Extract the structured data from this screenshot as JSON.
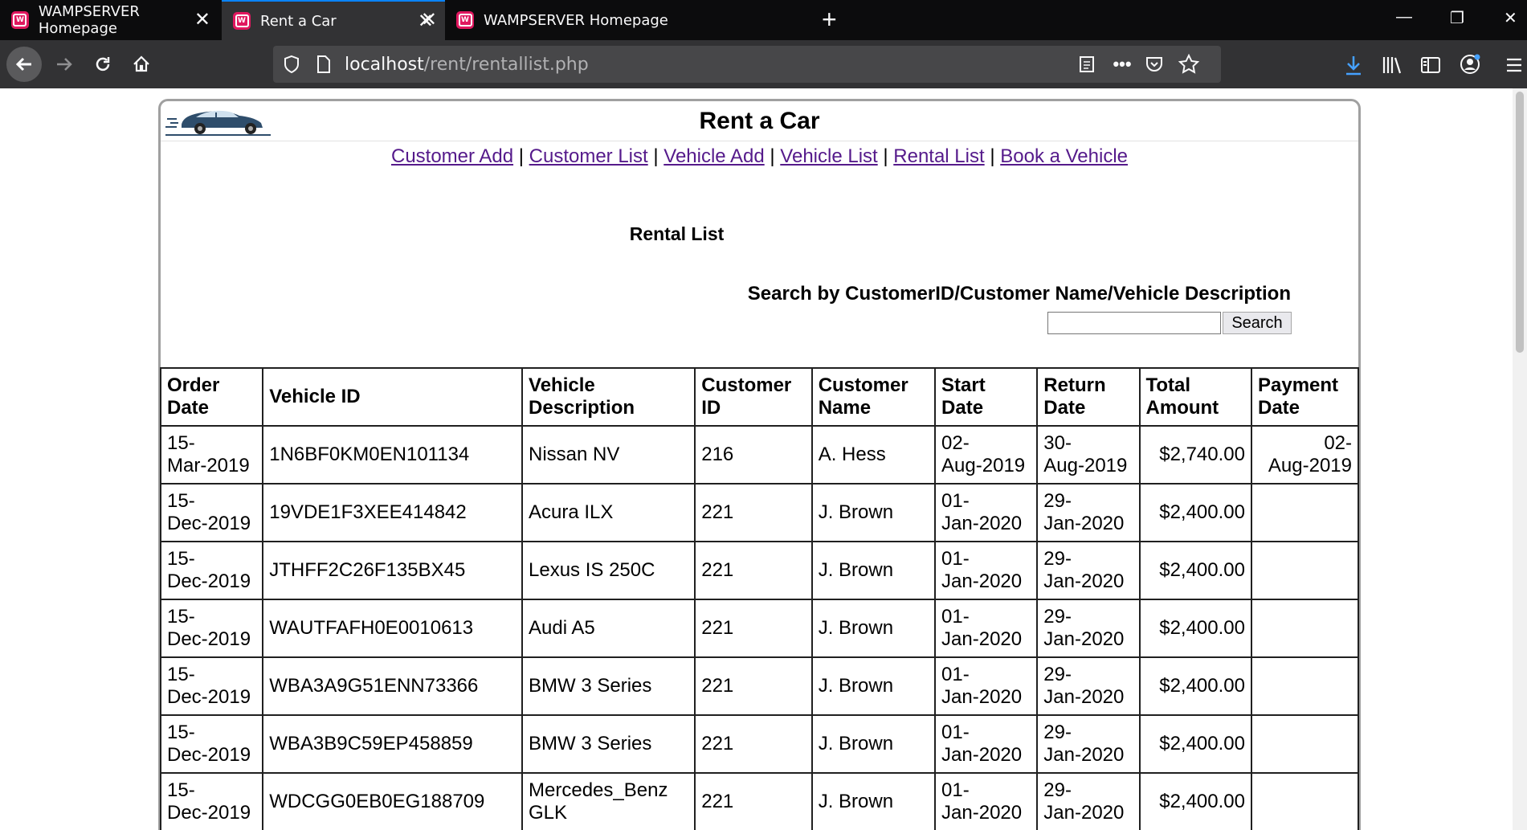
{
  "browser": {
    "tabs": [
      {
        "title": "WAMPSERVER Homepage",
        "active": false
      },
      {
        "title": "Rent a Car",
        "active": true
      },
      {
        "title": "WAMPSERVER Homepage",
        "active": false
      }
    ],
    "url_host": "localhost",
    "url_path": "/rent/rentallist.php"
  },
  "site": {
    "title": "Rent a Car"
  },
  "menu": {
    "items": [
      "Customer Add",
      "Customer List",
      "Vehicle Add",
      "Vehicle List",
      "Rental List",
      "Book a Vehicle"
    ],
    "separator": "|"
  },
  "page": {
    "heading": "Rental List",
    "search_label": "Search by CustomerID/Customer Name/Vehicle Description",
    "search_value": "",
    "search_button": "Search"
  },
  "table": {
    "headers": [
      [
        "Order",
        "Date"
      ],
      [
        "Vehicle ID"
      ],
      [
        "Vehicle",
        "Description"
      ],
      [
        "Customer",
        "ID"
      ],
      [
        "Customer",
        "Name"
      ],
      [
        "Start Date"
      ],
      [
        "Return",
        "Date"
      ],
      [
        "Total",
        "Amount"
      ],
      [
        "Payment",
        "Date"
      ]
    ],
    "rows": [
      {
        "order_date": [
          "15-",
          "Mar-2019"
        ],
        "vehicle_id": "1N6BF0KM0EN101134",
        "vehicle_desc": [
          "Nissan NV"
        ],
        "customer_id": "216",
        "customer_name": "A. Hess",
        "start_date": [
          "02-",
          "Aug-2019"
        ],
        "return_date": [
          "30-",
          "Aug-2019"
        ],
        "total_amount": "$2,740.00",
        "payment_date": [
          "02-",
          "Aug-2019"
        ]
      },
      {
        "order_date": [
          "15-",
          "Dec-2019"
        ],
        "vehicle_id": "19VDE1F3XEE414842",
        "vehicle_desc": [
          "Acura ILX"
        ],
        "customer_id": "221",
        "customer_name": "J. Brown",
        "start_date": [
          "01-",
          "Jan-2020"
        ],
        "return_date": [
          "29-",
          "Jan-2020"
        ],
        "total_amount": "$2,400.00",
        "payment_date": []
      },
      {
        "order_date": [
          "15-",
          "Dec-2019"
        ],
        "vehicle_id": "JTHFF2C26F135BX45",
        "vehicle_desc": [
          "Lexus IS 250C"
        ],
        "customer_id": "221",
        "customer_name": "J. Brown",
        "start_date": [
          "01-",
          "Jan-2020"
        ],
        "return_date": [
          "29-",
          "Jan-2020"
        ],
        "total_amount": "$2,400.00",
        "payment_date": []
      },
      {
        "order_date": [
          "15-",
          "Dec-2019"
        ],
        "vehicle_id": "WAUTFAFH0E0010613",
        "vehicle_desc": [
          "Audi A5"
        ],
        "customer_id": "221",
        "customer_name": "J. Brown",
        "start_date": [
          "01-",
          "Jan-2020"
        ],
        "return_date": [
          "29-",
          "Jan-2020"
        ],
        "total_amount": "$2,400.00",
        "payment_date": []
      },
      {
        "order_date": [
          "15-",
          "Dec-2019"
        ],
        "vehicle_id": "WBA3A9G51ENN73366",
        "vehicle_desc": [
          "BMW 3 Series"
        ],
        "customer_id": "221",
        "customer_name": "J. Brown",
        "start_date": [
          "01-",
          "Jan-2020"
        ],
        "return_date": [
          "29-",
          "Jan-2020"
        ],
        "total_amount": "$2,400.00",
        "payment_date": []
      },
      {
        "order_date": [
          "15-",
          "Dec-2019"
        ],
        "vehicle_id": "WBA3B9C59EP458859",
        "vehicle_desc": [
          "BMW 3 Series"
        ],
        "customer_id": "221",
        "customer_name": "J. Brown",
        "start_date": [
          "01-",
          "Jan-2020"
        ],
        "return_date": [
          "29-",
          "Jan-2020"
        ],
        "total_amount": "$2,400.00",
        "payment_date": []
      },
      {
        "order_date": [
          "15-",
          "Dec-2019"
        ],
        "vehicle_id": "WDCGG0EB0EG188709",
        "vehicle_desc": [
          "Mercedes_Benz",
          "GLK"
        ],
        "customer_id": "221",
        "customer_name": "J. Brown",
        "start_date": [
          "01-",
          "Jan-2020"
        ],
        "return_date": [
          "29-",
          "Jan-2020"
        ],
        "total_amount": "$2,400.00",
        "payment_date": []
      }
    ]
  },
  "colors": {
    "link_visited": "#551a8b",
    "tabbar_bg": "#0c0c0d",
    "toolbar_bg": "#323234",
    "favicon": "#e0185f",
    "active_tab_accent": "#0a84ff"
  },
  "icons": {
    "tab_favicon": "wampserver-icon",
    "tab_close": "close-icon",
    "new_tab": "plus-icon",
    "nav": [
      "back-arrow-icon",
      "forward-arrow-icon",
      "reload-icon",
      "home-icon"
    ],
    "url": [
      "shield-icon",
      "page-icon",
      "reader-view-icon",
      "more-icon",
      "pocket-icon",
      "bookmark-star-icon"
    ],
    "toolbar": [
      "download-icon",
      "library-icon",
      "sidebar-icon",
      "account-icon",
      "menu-icon"
    ],
    "logo": "car-logo"
  }
}
